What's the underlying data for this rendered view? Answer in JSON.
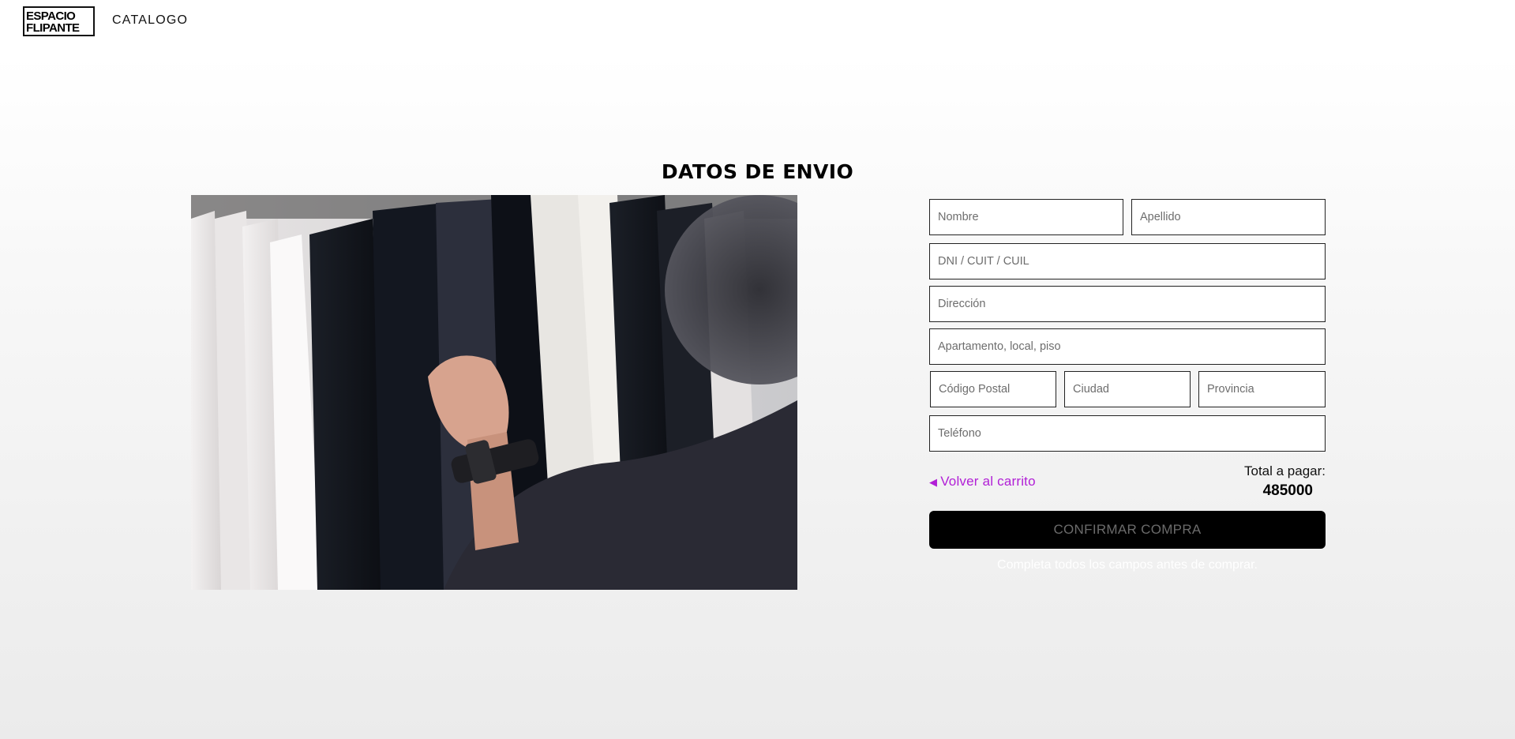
{
  "nav": {
    "logo_line1": "ESPACIO",
    "logo_line2": "FLIPANTE",
    "catalog_label": "CATALOGO"
  },
  "page": {
    "title": "DATOS DE ENVIO"
  },
  "hero_image": {
    "icon": "clothing-rack-photo"
  },
  "form": {
    "nombre_placeholder": "Nombre",
    "apellido_placeholder": "Apellido",
    "dni_placeholder": "DNI / CUIT / CUIL",
    "direccion_placeholder": "Dirección",
    "apartamento_placeholder": "Apartamento, local, piso",
    "codigo_postal_placeholder": "Código Postal",
    "ciudad_placeholder": "Ciudad",
    "provincia_placeholder": "Provincia",
    "telefono_placeholder": "Teléfono"
  },
  "summary": {
    "back_label": "Volver al carrito",
    "back_icon": "triangle-left-icon",
    "total_label": "Total a pagar:",
    "total_value": "485000",
    "confirm_label": "CONFIRMAR COMPRA",
    "hint": "Completa todos los campos antes de comprar."
  },
  "colors": {
    "accent": "#b11fd6",
    "button_bg": "#000000"
  }
}
